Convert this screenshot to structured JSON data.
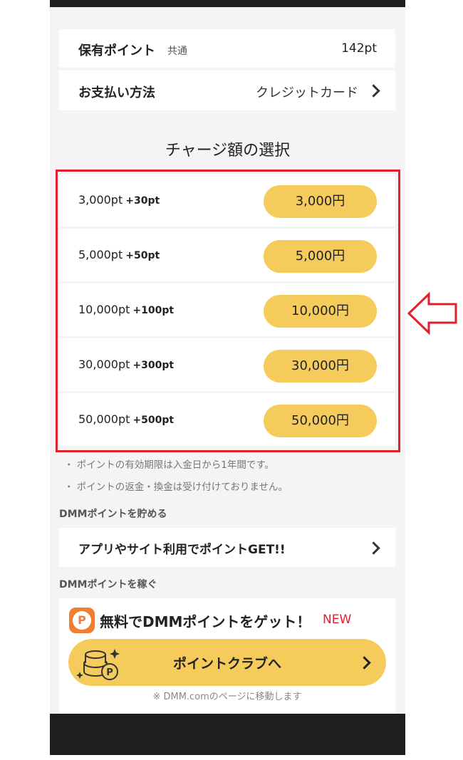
{
  "points": {
    "label": "保有ポイント",
    "shared": "共通",
    "value": "142pt"
  },
  "payment": {
    "label": "お支払い方法",
    "value": "クレジットカード"
  },
  "charge": {
    "title": "チャージ額の選択",
    "options": [
      {
        "points": "3,000pt",
        "bonus": "+30pt",
        "price": "3,000円"
      },
      {
        "points": "5,000pt",
        "bonus": "+50pt",
        "price": "5,000円"
      },
      {
        "points": "10,000pt",
        "bonus": "+100pt",
        "price": "10,000円"
      },
      {
        "points": "30,000pt",
        "bonus": "+300pt",
        "price": "30,000円"
      },
      {
        "points": "50,000pt",
        "bonus": "+500pt",
        "price": "50,000円"
      }
    ]
  },
  "notes": [
    "ポイントの有効期限は入金日から1年間です。",
    "ポイントの返金・換金は受け付けておりません。"
  ],
  "save_section": {
    "heading": "DMMポイントを貯める",
    "link": "アプリやサイト利用でポイントGET!!"
  },
  "earn_section": {
    "heading": "DMMポイントを稼ぐ",
    "headline": "無料でDMMポイントをゲット！",
    "badge": "NEW",
    "button": "ポイントクラブへ",
    "note": "※ DMM.comのページに移動します"
  },
  "colors": {
    "accent": "#f5cb5c",
    "highlight": "#e0202a",
    "logo": "#f07f32"
  }
}
